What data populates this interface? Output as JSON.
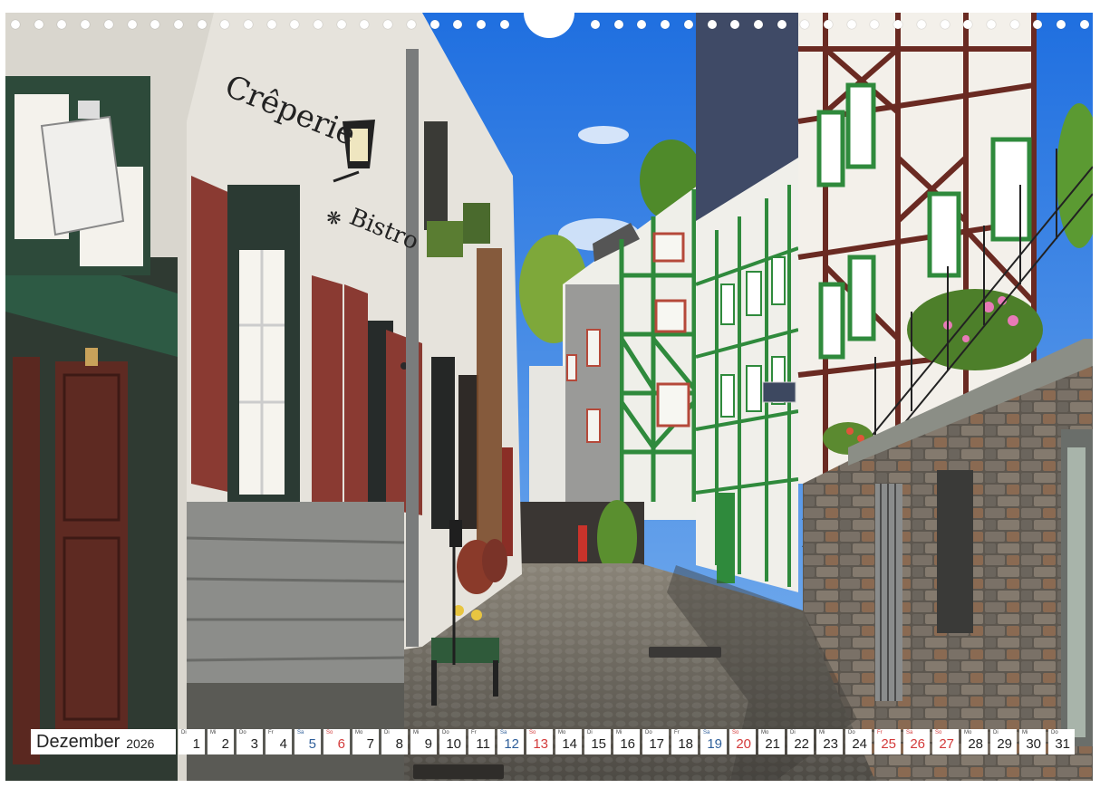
{
  "calendar": {
    "month": "Dezember",
    "year": "2026",
    "days": [
      {
        "dow": "Di",
        "day": "1",
        "kind": "weekday"
      },
      {
        "dow": "Mi",
        "day": "2",
        "kind": "weekday"
      },
      {
        "dow": "Do",
        "day": "3",
        "kind": "weekday"
      },
      {
        "dow": "Fr",
        "day": "4",
        "kind": "weekday"
      },
      {
        "dow": "Sa",
        "day": "5",
        "kind": "sat"
      },
      {
        "dow": "So",
        "day": "6",
        "kind": "sun"
      },
      {
        "dow": "Mo",
        "day": "7",
        "kind": "weekday"
      },
      {
        "dow": "Di",
        "day": "8",
        "kind": "weekday"
      },
      {
        "dow": "Mi",
        "day": "9",
        "kind": "weekday"
      },
      {
        "dow": "Do",
        "day": "10",
        "kind": "weekday"
      },
      {
        "dow": "Fr",
        "day": "11",
        "kind": "weekday"
      },
      {
        "dow": "Sa",
        "day": "12",
        "kind": "sat"
      },
      {
        "dow": "So",
        "day": "13",
        "kind": "sun"
      },
      {
        "dow": "Mo",
        "day": "14",
        "kind": "weekday"
      },
      {
        "dow": "Di",
        "day": "15",
        "kind": "weekday"
      },
      {
        "dow": "Mi",
        "day": "16",
        "kind": "weekday"
      },
      {
        "dow": "Do",
        "day": "17",
        "kind": "weekday"
      },
      {
        "dow": "Fr",
        "day": "18",
        "kind": "weekday"
      },
      {
        "dow": "Sa",
        "day": "19",
        "kind": "sat"
      },
      {
        "dow": "So",
        "day": "20",
        "kind": "sun"
      },
      {
        "dow": "Mo",
        "day": "21",
        "kind": "weekday"
      },
      {
        "dow": "Di",
        "day": "22",
        "kind": "weekday"
      },
      {
        "dow": "Mi",
        "day": "23",
        "kind": "weekday"
      },
      {
        "dow": "Do",
        "day": "24",
        "kind": "weekday"
      },
      {
        "dow": "Fr",
        "day": "25",
        "kind": "hol"
      },
      {
        "dow": "Sa",
        "day": "26",
        "kind": "hol"
      },
      {
        "dow": "So",
        "day": "27",
        "kind": "sun"
      },
      {
        "dow": "Mo",
        "day": "28",
        "kind": "weekday"
      },
      {
        "dow": "Di",
        "day": "29",
        "kind": "weekday"
      },
      {
        "dow": "Mi",
        "day": "30",
        "kind": "weekday"
      },
      {
        "dow": "Do",
        "day": "31",
        "kind": "weekday"
      }
    ]
  },
  "photo": {
    "sign_line_1": "Crêperie",
    "sign_separator": "❋",
    "sign_line_2": "Bistro"
  },
  "colors": {
    "sky": "#2f7fe0",
    "frame_green": "#2f8a3c",
    "shutter_red": "#8a3a32",
    "beam_brown": "#6a2a22",
    "cobble": "#6a6660",
    "sunday_red": "#d33a3a",
    "saturday_blue": "#2f5f9a"
  }
}
